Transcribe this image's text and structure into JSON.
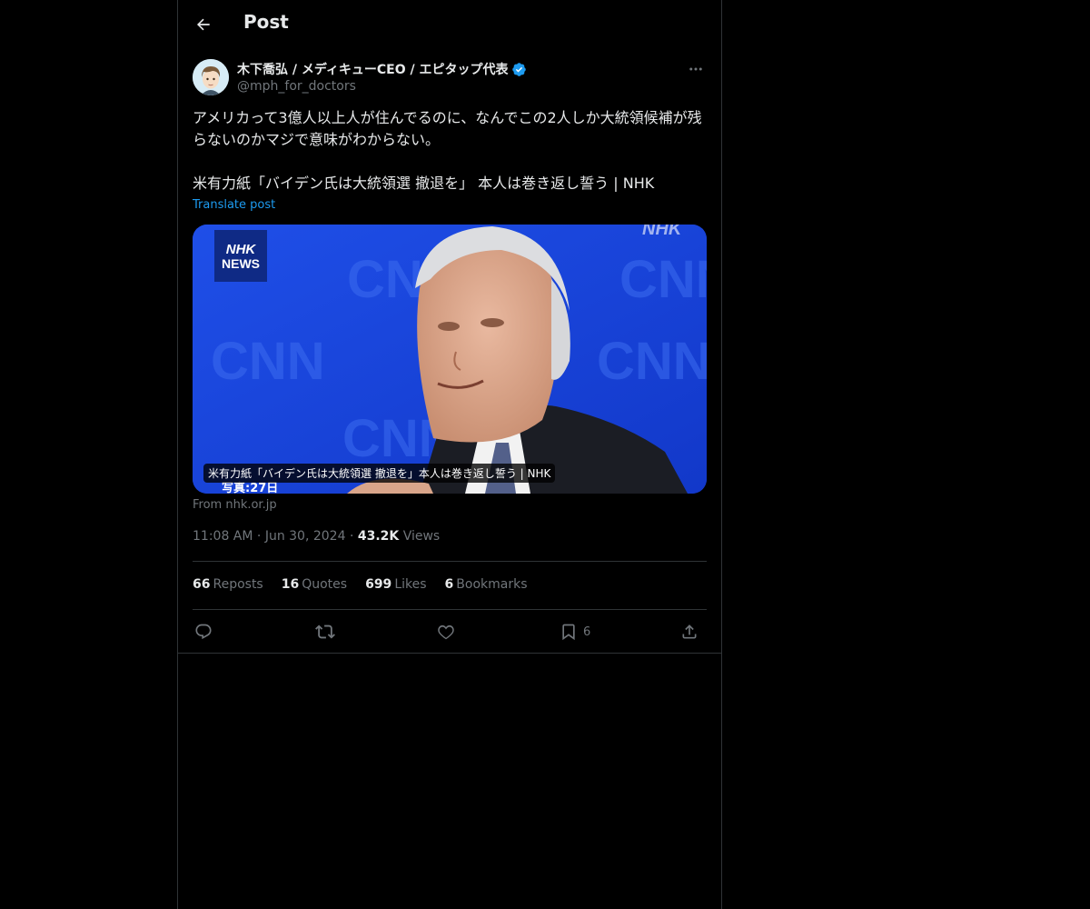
{
  "header": {
    "title": "Post"
  },
  "author": {
    "display_name": "木下喬弘 / メディキューCEO / エピタップ代表",
    "handle": "@mph_for_doctors",
    "verified": true
  },
  "post": {
    "text": "アメリカって3億人以上人が住んでるのに、なんでこの2人しか大統領候補が残らないのかマジで意味がわからない。\n\n米有力紙「バイデン氏は大統領選 撤退を」 本人は巻き返し誓う | NHK",
    "translate_label": "Translate post"
  },
  "card": {
    "logo_line1": "NHK",
    "logo_line2": "NEWS",
    "watermark": "NHK",
    "caption": "米有力紙「バイデン氏は大統領選 撤退を」本人は巻き返し誓う | NHK",
    "subtitle": "写真:27日",
    "source": "From nhk.or.jp"
  },
  "meta": {
    "time": "11:08 AM",
    "date": "Jun 30, 2024",
    "views_count": "43.2K",
    "views_label": "Views",
    "separator": "·"
  },
  "stats": {
    "reposts_count": "66",
    "reposts_label": "Reposts",
    "quotes_count": "16",
    "quotes_label": "Quotes",
    "likes_count": "699",
    "likes_label": "Likes",
    "bookmarks_count": "6",
    "bookmarks_label": "Bookmarks"
  },
  "actions": {
    "bookmark_count": "6"
  },
  "colors": {
    "background": "#000000",
    "text": "#e7e9ea",
    "muted": "#71767b",
    "accent": "#1d9bf0",
    "border": "#2f3336"
  },
  "icons": {
    "back": "arrow-left-icon",
    "verified": "verified-badge-icon",
    "more": "more-horizontal-icon",
    "reply": "reply-icon",
    "repost": "repost-icon",
    "like": "heart-icon",
    "bookmark": "bookmark-icon",
    "share": "share-icon"
  }
}
